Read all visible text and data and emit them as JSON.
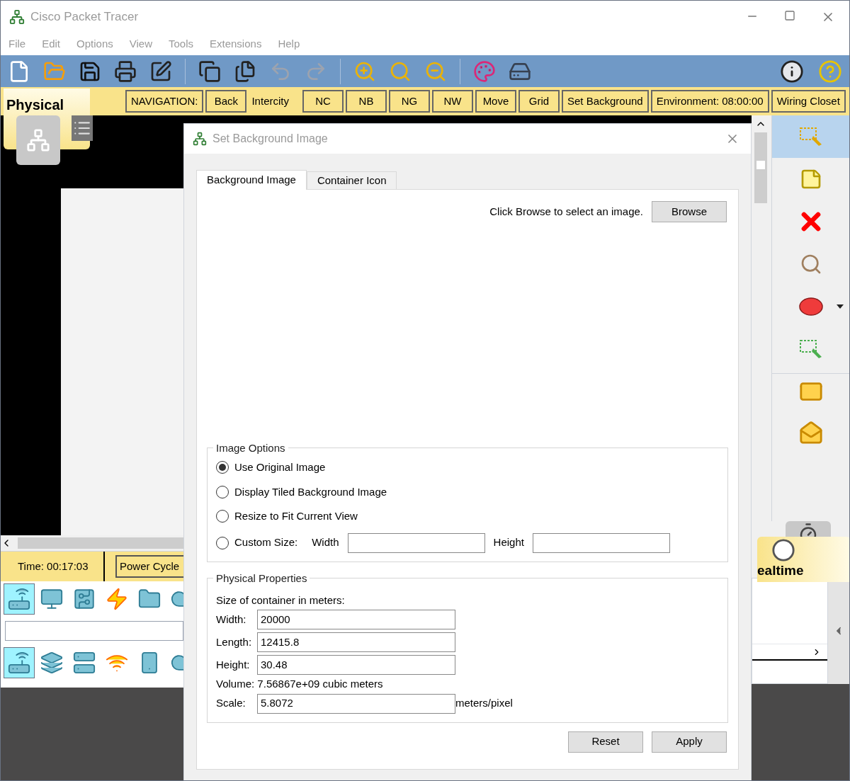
{
  "window": {
    "title": "Cisco Packet Tracer"
  },
  "menu": [
    "File",
    "Edit",
    "Options",
    "View",
    "Tools",
    "Extensions",
    "Help"
  ],
  "mode_tab": "Physical",
  "nav_items": [
    {
      "label": "NAVIGATION:",
      "kind": "button"
    },
    {
      "label": "Back",
      "kind": "button"
    },
    {
      "label": "Intercity",
      "kind": "label"
    },
    {
      "label": "NC",
      "kind": "button"
    },
    {
      "label": "NB",
      "kind": "button"
    },
    {
      "label": "NG",
      "kind": "button"
    },
    {
      "label": "NW",
      "kind": "button"
    },
    {
      "label": "Move",
      "kind": "button"
    },
    {
      "label": "Grid",
      "kind": "button"
    },
    {
      "label": "Set Background",
      "kind": "button"
    },
    {
      "label": "Environment: 08:00:00",
      "kind": "button"
    },
    {
      "label": "Wiring Closet",
      "kind": "button"
    }
  ],
  "tools": [
    {
      "selected": true
    },
    {
      "selected": false
    },
    {
      "selected": false
    },
    {
      "selected": false
    },
    {
      "selected": false
    },
    {
      "selected": false
    }
  ],
  "status": {
    "time": "Time: 00:17:03",
    "power_cycle": "Power Cycle "
  },
  "device_categories": [
    {
      "selected": true
    },
    {
      "selected": false
    },
    {
      "selected": false
    },
    {
      "selected": false
    },
    {
      "selected": false
    },
    {
      "selected": false
    }
  ],
  "device_types": [
    {
      "selected": true
    },
    {
      "selected": false
    },
    {
      "selected": false
    },
    {
      "selected": false
    },
    {
      "selected": false
    },
    {
      "selected": false
    }
  ],
  "realtime_tab": "ealtime",
  "dialog": {
    "title": "Set Background Image",
    "tabs": [
      {
        "label": "Background Image",
        "selected": true
      },
      {
        "label": "Container Icon",
        "selected": false
      }
    ],
    "prompt": "Click Browse to select an image.",
    "browse": "Browse",
    "image_options": {
      "title": "Image Options",
      "options": [
        {
          "label": "Use Original Image",
          "selected": true
        },
        {
          "label": "Display Tiled Background Image",
          "selected": false
        },
        {
          "label": "Resize to Fit Current View",
          "selected": false
        },
        {
          "label": "Custom Size:",
          "selected": false
        }
      ],
      "width_label": "Width",
      "height_label": "Height"
    },
    "physical": {
      "title": "Physical Properties",
      "subtitle": "Size of container in meters:",
      "fields": [
        {
          "label": "Width:",
          "value": "20000"
        },
        {
          "label": "Length:",
          "value": "12415.8"
        },
        {
          "label": "Height:",
          "value": "30.48"
        }
      ],
      "volume": "Volume: 7.56867e+09 cubic meters",
      "scale_label": "Scale:",
      "scale_value": "5.8072",
      "scale_unit": "meters/pixel"
    },
    "buttons": [
      "Reset",
      "Apply"
    ]
  }
}
